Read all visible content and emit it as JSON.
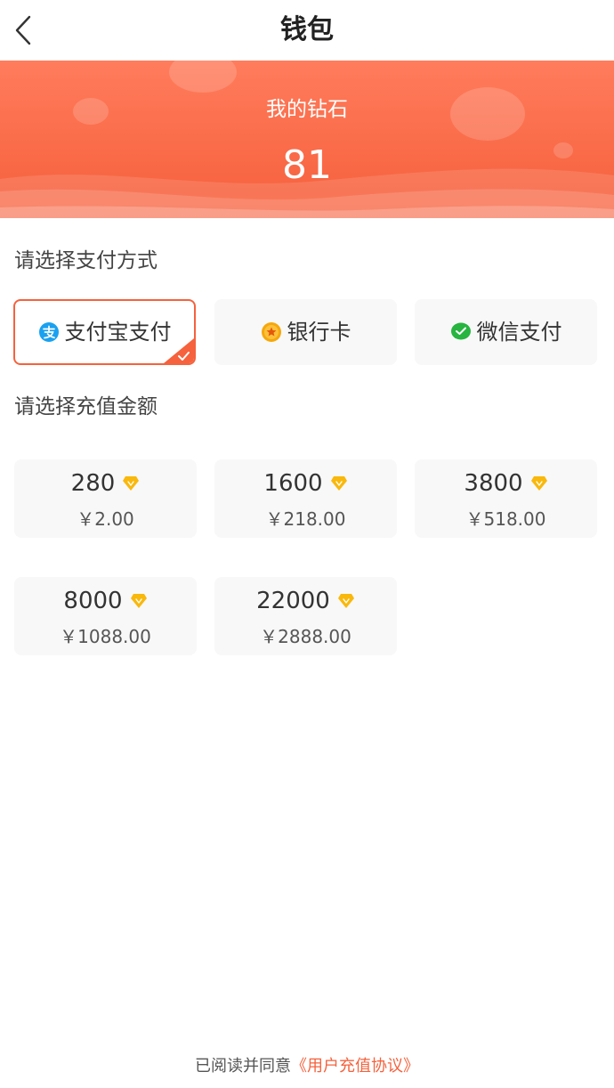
{
  "header": {
    "title": "钱包"
  },
  "banner": {
    "label": "我的钻石",
    "value": "81"
  },
  "payment_section": {
    "title": "请选择支付方式",
    "methods": [
      {
        "label": "支付宝支付",
        "icon": "alipay-icon",
        "color": "#1aa1f0",
        "selected": true
      },
      {
        "label": "银行卡",
        "icon": "bank-card-icon",
        "color": "#f6a70b",
        "selected": false
      },
      {
        "label": "微信支付",
        "icon": "wechat-pay-icon",
        "color": "#27b43f",
        "selected": false
      }
    ]
  },
  "amount_section": {
    "title": "请选择充值金额",
    "options": [
      {
        "amount": "280",
        "price": "￥2.00"
      },
      {
        "amount": "1600",
        "price": "￥218.00"
      },
      {
        "amount": "3800",
        "price": "￥518.00"
      },
      {
        "amount": "8000",
        "price": "￥1088.00"
      },
      {
        "amount": "22000",
        "price": "￥2888.00"
      }
    ]
  },
  "footer": {
    "agreement_prefix": "已阅读并同意",
    "agreement_link": "《用户充值协议》"
  },
  "colors": {
    "accent": "#f5623d",
    "banner_top": "#ff7c5c",
    "banner_bottom": "#f65f3b",
    "diamond": "#f9b80c"
  }
}
